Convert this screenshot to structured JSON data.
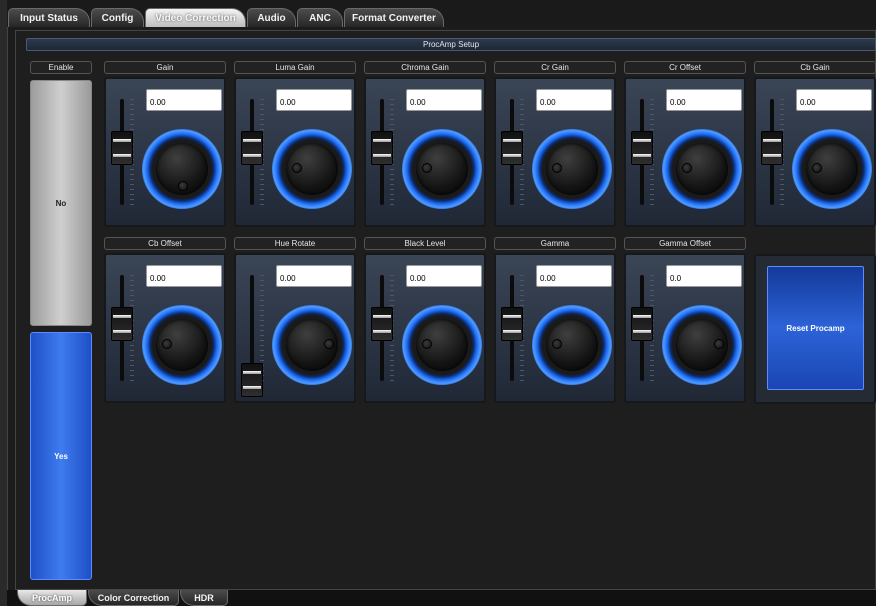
{
  "tabs": [
    {
      "label": "Input Status"
    },
    {
      "label": "Config"
    },
    {
      "label": "Video Correction",
      "active": true
    },
    {
      "label": "Audio"
    },
    {
      "label": "ANC"
    },
    {
      "label": "Format Converter"
    }
  ],
  "section_title": "ProcAmp Setup",
  "enable": {
    "label": "Enable",
    "no_label": "No",
    "yes_label": "Yes",
    "selected": "Yes"
  },
  "controls": [
    {
      "label": "Gain",
      "value": "0.00",
      "slider_level": 0.5
    },
    {
      "label": "Luma Gain",
      "value": "0.00",
      "slider_level": 0.5
    },
    {
      "label": "Chroma Gain",
      "value": "0.00",
      "slider_level": 0.5
    },
    {
      "label": "Cr Gain",
      "value": "0.00",
      "slider_level": 0.5
    },
    {
      "label": "Cr Offset",
      "value": "0.00",
      "slider_level": 0.5
    },
    {
      "label": "Cb Gain",
      "value": "0.00",
      "slider_level": 0.5
    },
    {
      "label": "Cb Offset",
      "value": "0.00",
      "slider_level": 0.5
    },
    {
      "label": "Hue Rotate",
      "value": "0.00",
      "slider_level": 0.0
    },
    {
      "label": "Black Level",
      "value": "0.00",
      "slider_level": 0.5
    },
    {
      "label": "Gamma",
      "value": "0.00",
      "slider_level": 0.5
    },
    {
      "label": "Gamma Offset",
      "value": "0.0",
      "slider_level": 0.5
    }
  ],
  "reset_button": "Reset Procamp",
  "bottom_tabs": [
    {
      "label": "ProcAmp",
      "active": true
    },
    {
      "label": "Color Correction"
    },
    {
      "label": "HDR"
    }
  ],
  "colors": {
    "accent": "#2c63d8",
    "knob_ring": "#1e6cf5",
    "background": "#1c1c1c"
  }
}
